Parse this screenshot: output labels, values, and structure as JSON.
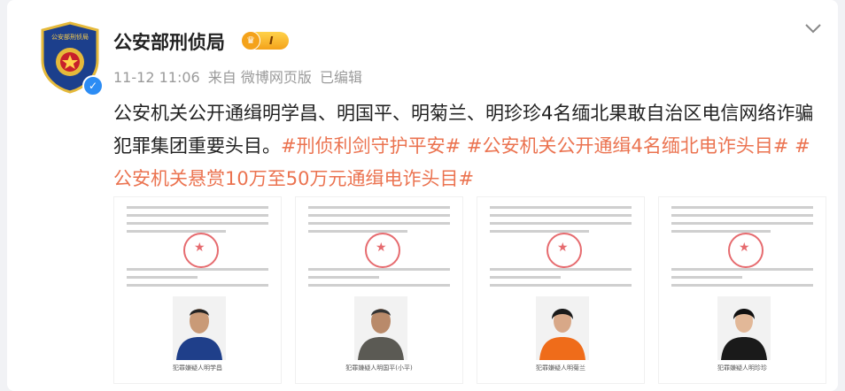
{
  "account": {
    "name": "公安部刑侦局",
    "badge_level": "I",
    "avatar_icon": "police-emblem-icon",
    "verified_icon": "verified-check-icon"
  },
  "post": {
    "timestamp": "11-12 11:06",
    "source": "来自 微博网页版",
    "edited": "已编辑",
    "text": "公安机关公开通缉明学昌、明国平、明菊兰、明珍珍4名缅北果敢自治区电信网络诈骗犯罪集团重要头目。",
    "hashtags": [
      "#刑侦利剑守护平安#",
      "#公安机关公开通缉4名缅北电诈头目#",
      "#公安机关悬赏10万至50万元通缉电诈头目#"
    ]
  },
  "images": [
    {
      "caption": "犯罪嫌疑人明学昌",
      "shirt": "#1f3f8a"
    },
    {
      "caption": "犯罪嫌疑人明国平(小平)",
      "shirt": "#5b5a54"
    },
    {
      "caption": "犯罪嫌疑人明菊兰",
      "shirt": "#ef6c1a"
    },
    {
      "caption": "犯罪嫌疑人明珍珍",
      "shirt": "#1a1a1a"
    }
  ],
  "colors": {
    "accent": "#eb7350",
    "verified": "#2c8cf4"
  }
}
